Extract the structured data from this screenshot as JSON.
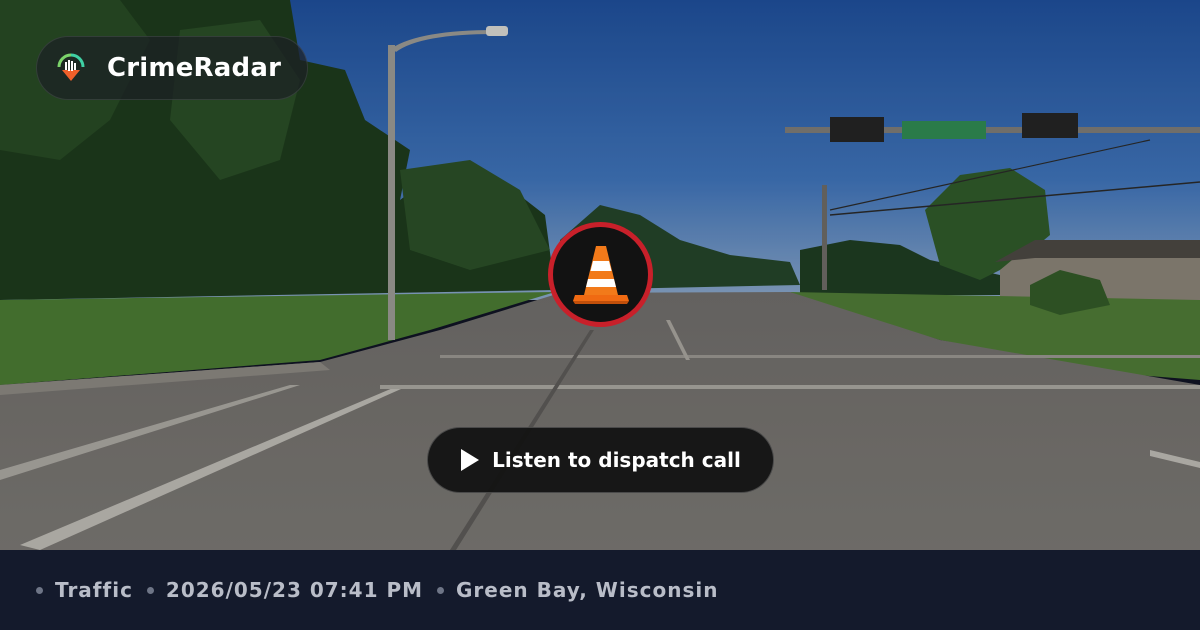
{
  "brand": {
    "name": "CrimeRadar",
    "logo_icon": "radar-pin-icon",
    "logo_colors": [
      "#3fd0a4",
      "#f0602a",
      "#ffffff"
    ]
  },
  "incident": {
    "category_icon": "traffic-cone-icon",
    "badge_ring_color": "#c8202a"
  },
  "player": {
    "button_label": "Listen to dispatch call",
    "icon": "play-icon"
  },
  "footer": {
    "category": "Traffic",
    "datetime": "2026/05/23 07:41 PM",
    "location": "Green Bay, Wisconsin"
  },
  "scene": {
    "description_icon": "street-view-photo",
    "sign_text": ""
  }
}
